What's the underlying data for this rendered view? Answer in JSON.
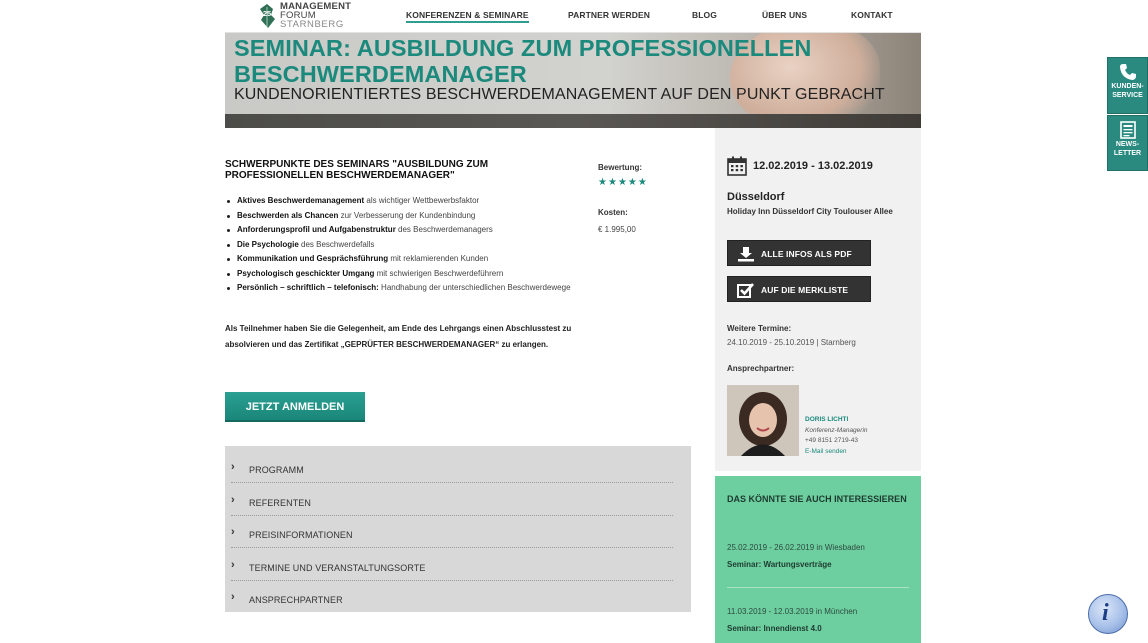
{
  "header": {
    "logo": {
      "badge": "25",
      "line1": "MANAGEMENT",
      "line2": "FORUM",
      "line3": "STARNBERG"
    },
    "nav": [
      "KONFERENZEN & SEMINARE",
      "PARTNER WERDEN",
      "BLOG",
      "ÜBER UNS",
      "KONTAKT"
    ],
    "active_index": 0
  },
  "hero": {
    "title_line1": "SEMINAR: AUSBILDUNG ZUM PROFESSIONELLEN",
    "title_line2": "BESCHWERDEMANAGER",
    "subtitle": "KUNDENORIENTIERTES BESCHWERDEMANAGEMENT AUF DEN PUNKT GEBRACHT"
  },
  "main": {
    "section_title": "SCHWERPUNKTE DES SEMINARS \"AUSBILDUNG ZUM PROFESSIONELLEN BESCHWERDEMANAGER\"",
    "bullets": [
      {
        "bold": "Aktives Beschwerdemanagement",
        "rest": " als wichtiger Wettbewerbsfaktor"
      },
      {
        "bold": "Beschwerden als Chancen",
        "rest": " zur Verbesserung der Kundenbindung"
      },
      {
        "bold": "Anforderungsprofil und Aufgabenstruktur",
        "rest": " des Beschwerdemanagers"
      },
      {
        "bold": "Die Psychologie",
        "rest": " des Beschwerdefalls"
      },
      {
        "bold": "Kommunikation und Gesprächsführung",
        "rest": " mit reklamierenden Kunden"
      },
      {
        "bold": "Psychologisch geschickter Umgang",
        "rest": " mit schwierigen Beschwerdeführern"
      },
      {
        "bold": "Persönlich – schriftlich – telefonisch:",
        "rest": " Handhabung der unterschiedlichen Beschwerdewege"
      }
    ],
    "participants_text": "Als Teilnehmer haben Sie die Gelegenheit, am Ende des Lehrgangs einen Abschlusstest zu absolvieren und das Zertifikat „GEPRÜFTER BESCHWERDEMANAGER“ zu erlangen.",
    "cta_label": "JETZT ANMELDEN",
    "rating_label": "Bewertung:",
    "rating_stars": 5,
    "cost_label": "Kosten:",
    "cost_value": "€ 1.995,00"
  },
  "accordion": [
    "PROGRAMM",
    "REFERENTEN",
    "PREISINFORMATIONEN",
    "TERMINE UND VERANSTALTUNGSORTE",
    "ANSPRECHPARTNER"
  ],
  "sidebar": {
    "date": "12.02.2019 - 13.02.2019",
    "city": "Düsseldorf",
    "venue": "Holiday Inn Düsseldorf City Toulouser Allee",
    "pdf_button": "ALLE INFOS ALS PDF",
    "merkliste_button": "AUF DIE MERKLISTE",
    "further_dates_label": "Weitere Termine:",
    "further_dates": "24.10.2019 - 25.10.2019 | Starnberg",
    "contact_label": "Ansprechpartner:",
    "contact": {
      "name": "DORIS LICHTI",
      "role": "Konferenz-Managerin",
      "phone": "+49 8151 2719-43",
      "mail": "E-Mail senden"
    }
  },
  "suggestions": {
    "title": "DAS KÖNNTE SIE AUCH INTERESSIEREN",
    "items": [
      {
        "date": "25.02.2019 - 26.02.2019",
        "loc": " in Wiesbaden",
        "name": "Seminar: Wartungsverträge"
      },
      {
        "date": "11.03.2019 - 12.03.2019",
        "loc": " in München",
        "name": "Seminar: Innendienst 4.0"
      }
    ]
  },
  "float_tabs": [
    {
      "line1": "KUNDEN-",
      "line2": "SERVICE",
      "icon": "phone-icon"
    },
    {
      "line1": "NEWS-",
      "line2": "LETTER",
      "icon": "newspaper-icon"
    }
  ],
  "info_button": "i",
  "colors": {
    "brand_green": "#1b8a7d",
    "cta": "#1f9084",
    "suggest_bg": "#6dcfa0",
    "accordion_bg": "#d8d8d8"
  }
}
